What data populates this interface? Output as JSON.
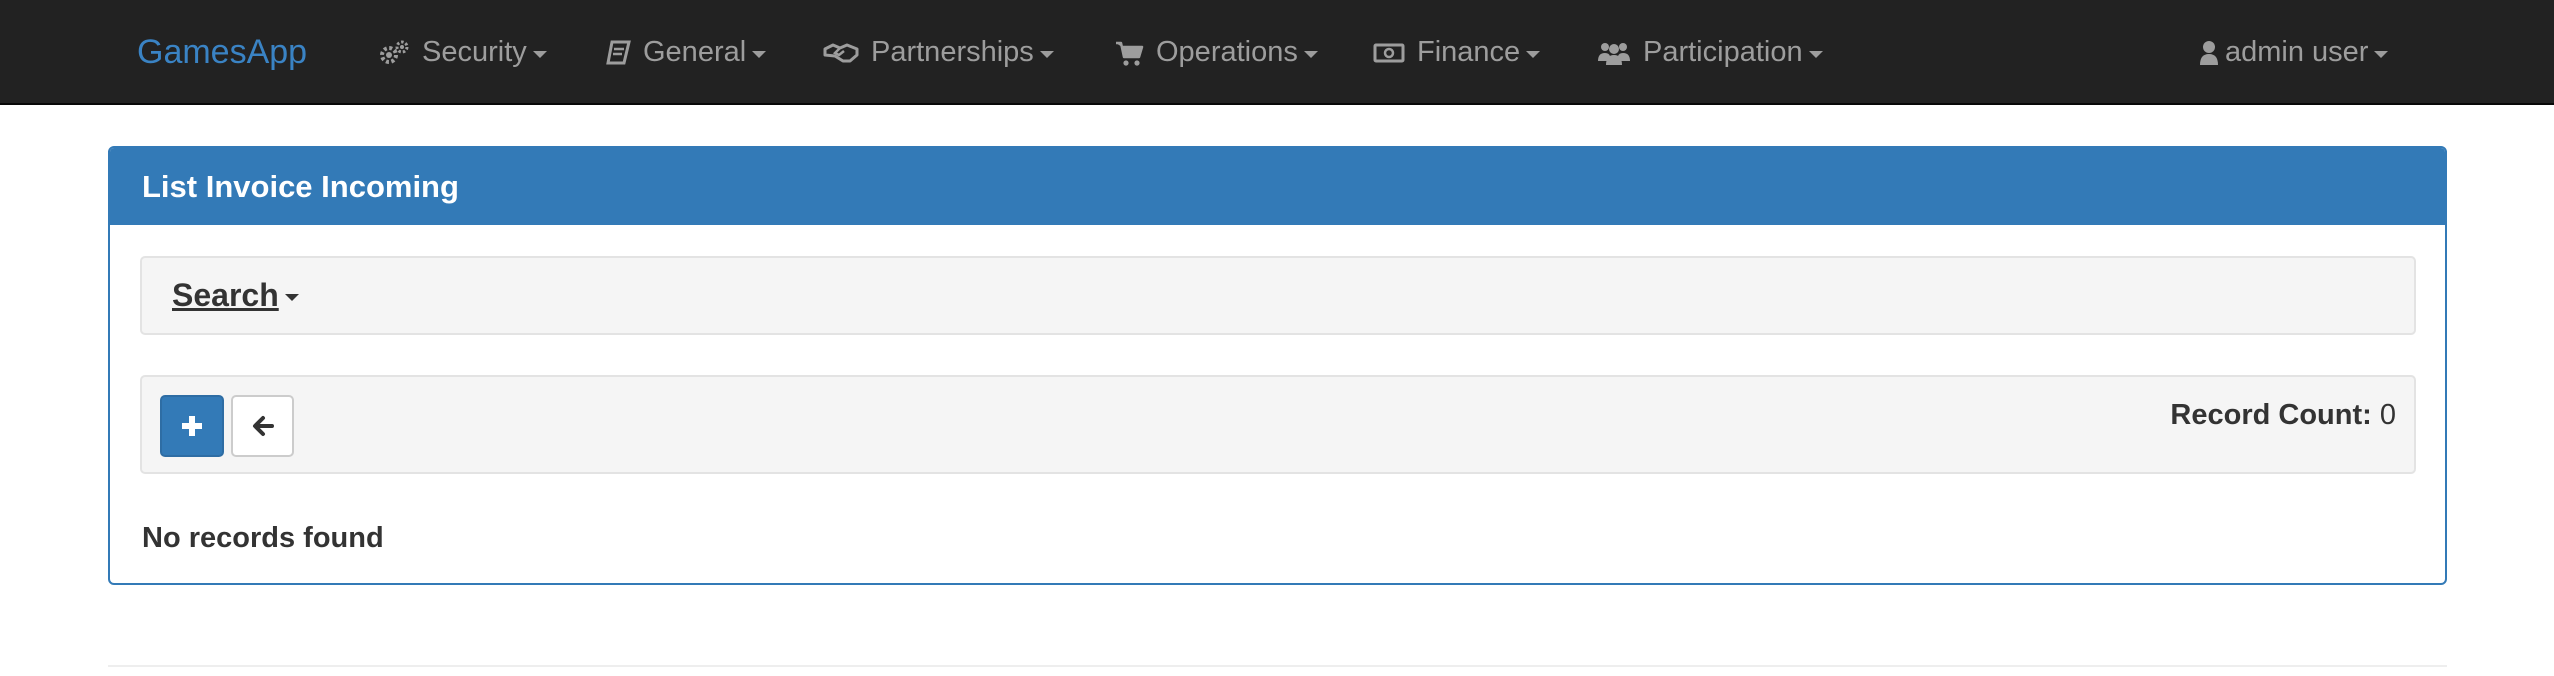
{
  "navbar": {
    "brand": "GamesApp",
    "items": [
      {
        "label": "Security",
        "icon": "gears-icon"
      },
      {
        "label": "General",
        "icon": "book-icon"
      },
      {
        "label": "Partnerships",
        "icon": "handshake-icon"
      },
      {
        "label": "Operations",
        "icon": "shopping-cart-icon"
      },
      {
        "label": "Finance",
        "icon": "money-icon"
      },
      {
        "label": "Participation",
        "icon": "users-icon"
      }
    ],
    "user": {
      "label": "admin user",
      "icon": "user-icon"
    }
  },
  "panel": {
    "title": "List Invoice Incoming",
    "search_label": "Search",
    "add_button_icon": "plus-icon",
    "back_button_icon": "arrow-left-icon",
    "record_count_label": "Record Count:",
    "record_count_value": "0",
    "empty_message": "No records found"
  },
  "colors": {
    "navbar_bg": "#222222",
    "brand": "#3a83c4",
    "nav_text": "#9d9d9d",
    "primary": "#337ab7",
    "well_bg": "#f5f5f5"
  }
}
